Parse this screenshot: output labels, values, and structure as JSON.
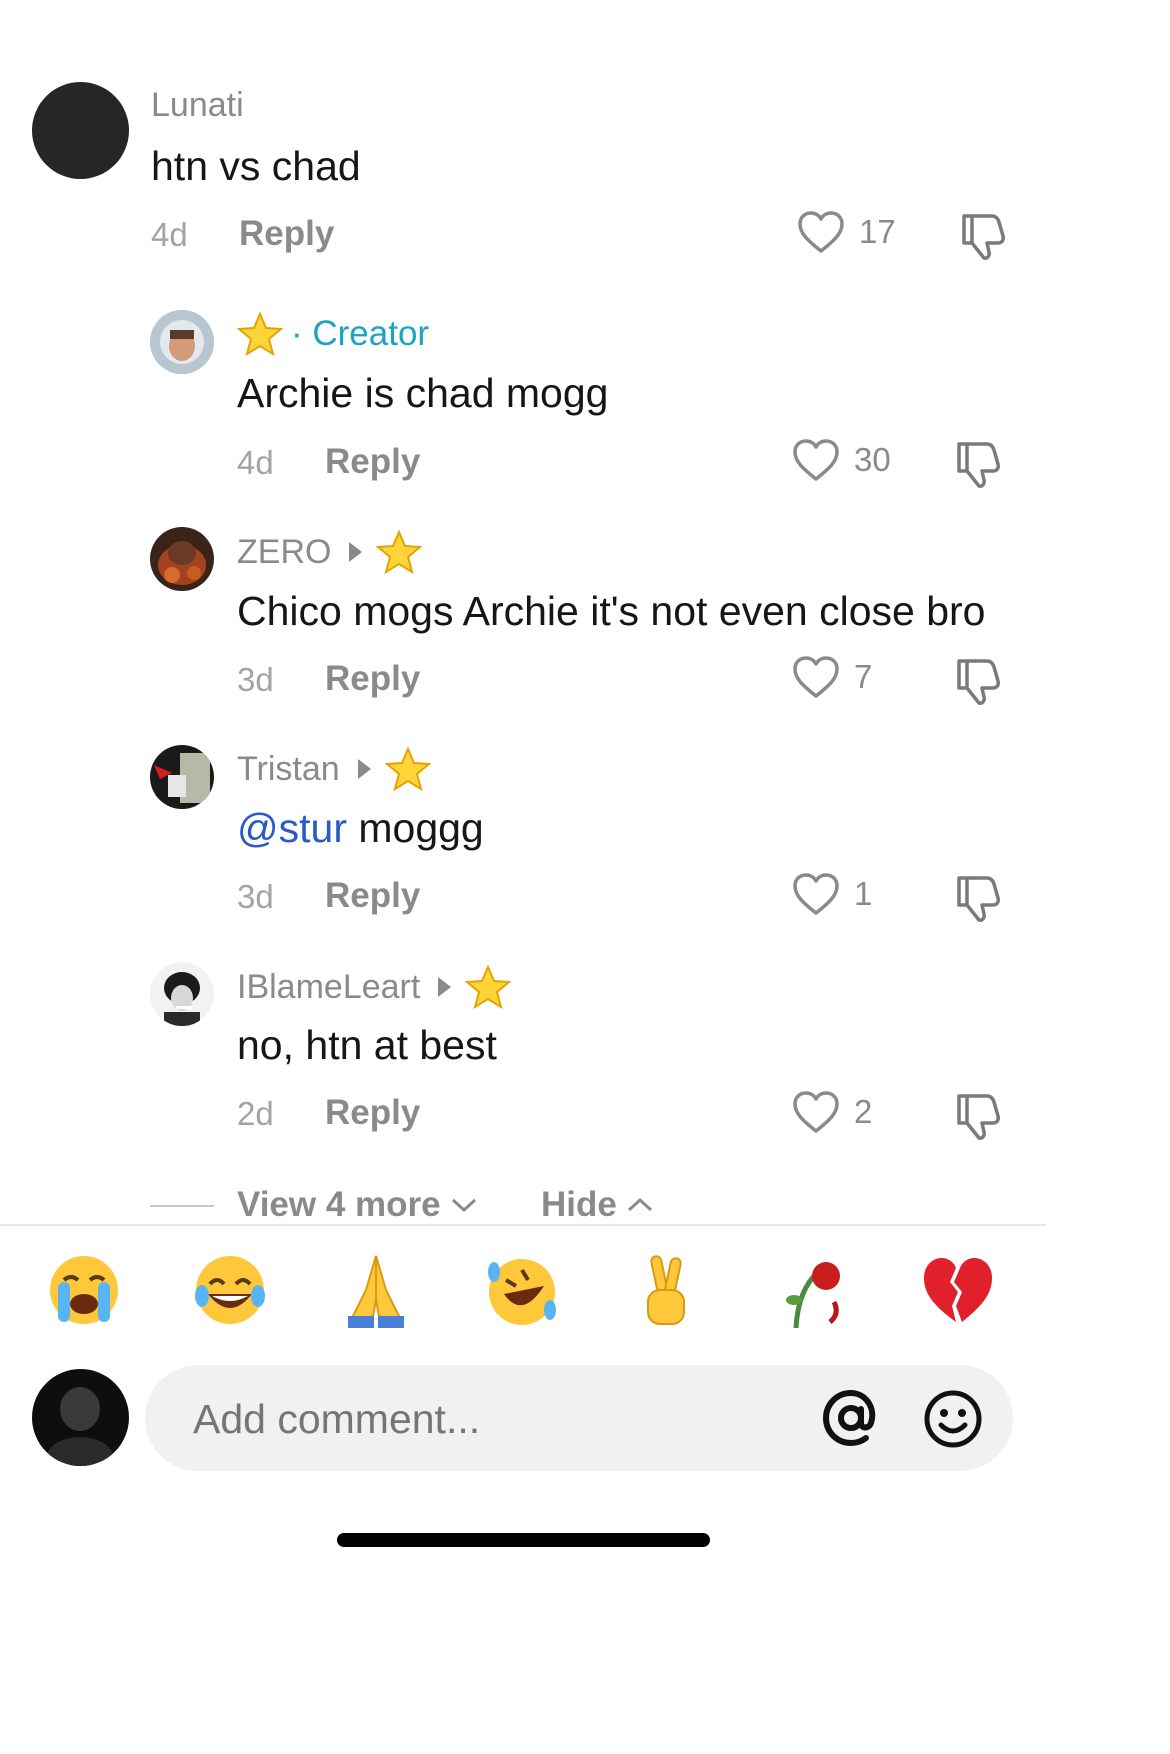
{
  "comments": [
    {
      "name": "Lunati",
      "text": "htn vs chad",
      "time": "4d",
      "reply": "Reply",
      "likes": "17"
    },
    {
      "name": "· Creator",
      "text": "Archie is chad mogg",
      "time": "4d",
      "reply": "Reply",
      "likes": "30"
    },
    {
      "name": "ZERO",
      "text": "Chico mogs Archie it's not even close bro",
      "time": "3d",
      "reply": "Reply",
      "likes": "7"
    },
    {
      "name": "Tristan",
      "mention": "@stur",
      "text": " moggg",
      "time": "3d",
      "reply": "Reply",
      "likes": "1"
    },
    {
      "name": "IBlameLeart",
      "text": "no, htn at best",
      "time": "2d",
      "reply": "Reply",
      "likes": "2"
    }
  ],
  "thread": {
    "view_more": "View 4 more",
    "hide": "Hide"
  },
  "emoji_bar": [
    "loudly-crying-face",
    "face-with-tears-of-joy",
    "folded-hands",
    "rolling-on-floor-laughing",
    "victory-hand",
    "wilted-flower",
    "broken-heart"
  ],
  "composer": {
    "placeholder": "Add comment..."
  },
  "colors": {
    "accent_creator": "#1ba4c4",
    "mention": "#2a5bc4"
  }
}
